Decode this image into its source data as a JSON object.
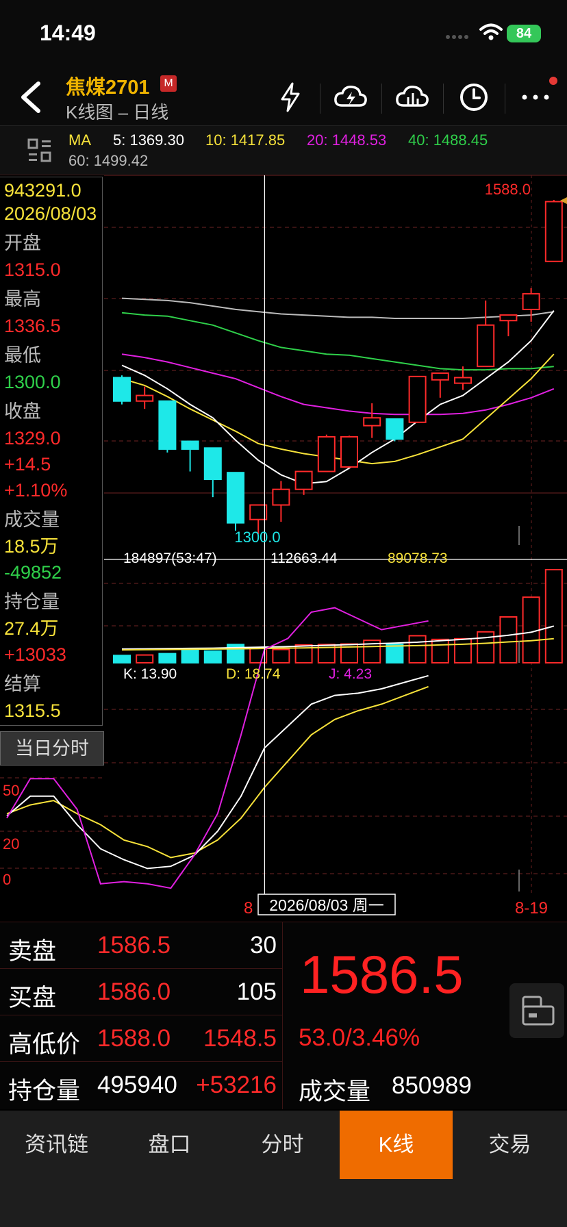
{
  "status_bar": {
    "time": "14:49",
    "battery": "84"
  },
  "header": {
    "title": "焦煤2701",
    "badge": "M",
    "subtitle": "K线图 – 日线"
  },
  "ma_bar": {
    "label": "MA",
    "ma5": "5: 1369.30",
    "ma10": "10: 1417.85",
    "ma20": "20: 1448.53",
    "ma40": "40: 1488.45",
    "ma60": "60: 1499.42"
  },
  "colors": {
    "up": "#ff2a2a",
    "down": "#1ee8e8",
    "ma5": "#ffffff",
    "ma10": "#f7e23a",
    "ma20": "#e020e0",
    "ma40": "#2fd04a",
    "ma60": "#bbbbbb",
    "accent": "#ef6c00"
  },
  "crosshair_info": {
    "value": "943291.0",
    "date": "2026/08/03",
    "open_label": "开盘",
    "open": "1315.0",
    "high_label": "最高",
    "high": "1336.5",
    "low_label": "最低",
    "low": "1300.0",
    "close_label": "收盘",
    "close": "1329.0",
    "change": "+14.5",
    "change_pct": "+1.10%",
    "volume_label": "成交量",
    "volume": "18.5万",
    "volume_change": "-49852",
    "oi_label": "持仓量",
    "oi": "27.4万",
    "oi_change": "+13033",
    "settle_label": "结算",
    "settle": "1315.5",
    "intraday_button": "当日分时"
  },
  "price_chart": {
    "max_label": "1588.0",
    "min_label": "1300.0",
    "candles": [
      {
        "o": 1429,
        "h": 1431,
        "l": 1405,
        "c": 1408
      },
      {
        "o": 1408,
        "h": 1421,
        "l": 1401,
        "c": 1413
      },
      {
        "o": 1408,
        "h": 1408,
        "l": 1362,
        "c": 1365
      },
      {
        "o": 1372,
        "h": 1372,
        "l": 1345,
        "c": 1365
      },
      {
        "o": 1366,
        "h": 1366,
        "l": 1322,
        "c": 1338
      },
      {
        "o": 1344,
        "h": 1344,
        "l": 1292,
        "c": 1299
      },
      {
        "o": 1302,
        "h": 1312,
        "l": 1289,
        "c": 1315
      },
      {
        "o": 1315,
        "h": 1336.5,
        "l": 1300,
        "c": 1329
      },
      {
        "o": 1329,
        "h": 1342,
        "l": 1324,
        "c": 1345
      },
      {
        "o": 1345,
        "h": 1378,
        "l": 1345,
        "c": 1376
      },
      {
        "o": 1349,
        "h": 1377,
        "l": 1349,
        "c": 1376
      },
      {
        "o": 1386,
        "h": 1406,
        "l": 1375,
        "c": 1393
      },
      {
        "o": 1392,
        "h": 1392,
        "l": 1372,
        "c": 1374
      },
      {
        "o": 1389,
        "h": 1429,
        "l": 1389,
        "c": 1430
      },
      {
        "o": 1427,
        "h": 1433,
        "l": 1411,
        "c": 1433
      },
      {
        "o": 1424,
        "h": 1439,
        "l": 1418,
        "c": 1429
      },
      {
        "o": 1439,
        "h": 1498,
        "l": 1439,
        "c": 1476
      },
      {
        "o": 1480,
        "h": 1485,
        "l": 1466,
        "c": 1485
      },
      {
        "o": 1490,
        "h": 1509,
        "l": 1479,
        "c": 1504
      },
      {
        "o": 1533,
        "h": 1588,
        "l": 1533,
        "c": 1586.5
      }
    ],
    "ma5": [
      1440,
      1431,
      1419,
      1405,
      1393,
      1373,
      1355,
      1342,
      1334,
      1336,
      1348,
      1362,
      1374,
      1390,
      1405,
      1413,
      1428,
      1443,
      1462,
      1489
    ],
    "ma10": [
      1428,
      1422,
      1412,
      1401,
      1391,
      1381,
      1370,
      1365,
      1361,
      1358,
      1355,
      1352,
      1354,
      1360,
      1367,
      1374,
      1392,
      1410,
      1428,
      1450
    ],
    "ma20": [
      1450,
      1447,
      1443,
      1438,
      1433,
      1428,
      1420,
      1412,
      1405,
      1402,
      1399,
      1397,
      1396,
      1396,
      1396,
      1397,
      1400,
      1405,
      1411,
      1419
    ],
    "ma40": [
      1487,
      1485,
      1484,
      1480,
      1476,
      1469,
      1462,
      1456,
      1453,
      1450,
      1449,
      1446,
      1443,
      1440,
      1437,
      1436,
      1436,
      1437,
      1437,
      1439
    ],
    "ma60": [
      1500,
      1499,
      1498,
      1496,
      1493,
      1490,
      1488,
      1486,
      1485,
      1484,
      1483,
      1483,
      1482,
      1482,
      1482,
      1482,
      1483,
      1484,
      1485,
      1488
    ]
  },
  "volume_chart": {
    "header_a": "184897(53:47)",
    "header_b": "112663.44",
    "header_c": "89078.73",
    "bars": [
      32000,
      34000,
      40000,
      55000,
      51000,
      80000,
      66000,
      58000,
      78000,
      80000,
      82000,
      98000,
      80000,
      118000,
      102000,
      105000,
      135000,
      200000,
      286000,
      406000
    ],
    "ma_white": [
      60000,
      61000,
      62000,
      63000,
      64000,
      66000,
      68000,
      70000,
      73000,
      76000,
      79000,
      83000,
      86000,
      90000,
      96000,
      102000,
      110000,
      120000,
      133000,
      160000
    ],
    "ma_yellow": [
      56000,
      57000,
      58000,
      59000,
      60000,
      61000,
      62000,
      64000,
      65000,
      67000,
      69000,
      71000,
      73000,
      75000,
      78000,
      81000,
      85000,
      91000,
      96000,
      105000
    ]
  },
  "kdj_chart": {
    "k_label": "K: 13.90",
    "d_label": "D: 18.74",
    "j_label": "J: 4.23",
    "y_labels": [
      "50",
      "20",
      "0"
    ],
    "k": [
      27,
      36,
      36,
      23,
      12,
      7,
      3,
      4,
      9,
      20,
      36,
      58,
      68,
      78,
      82,
      83,
      85,
      88,
      91
    ],
    "d": [
      28,
      32,
      34,
      28,
      23,
      16,
      13,
      8,
      10,
      16,
      26,
      40,
      52,
      64,
      71,
      75,
      78,
      82,
      86
    ],
    "j": [
      26,
      44,
      44,
      30,
      -4,
      -3,
      -4,
      -6,
      9,
      28,
      64,
      103,
      108,
      120,
      122,
      117,
      112,
      114,
      116
    ]
  },
  "x_axis": {
    "left_label": "8",
    "cursor_label": "2026/08/03 周一",
    "right_label": "8-19"
  },
  "quote": {
    "ask_label": "卖盘",
    "ask_price": "1586.5",
    "ask_qty": "30",
    "bid_label": "买盘",
    "bid_price": "1586.0",
    "bid_qty": "105",
    "hl_label": "高低价",
    "high_price": "1588.0",
    "low_price": "1548.5",
    "oi_label": "持仓量",
    "oi_value": "495940",
    "oi_change": "+53216",
    "last_price": "1586.5",
    "change": "53.0/3.46%",
    "volume_label": "成交量",
    "volume_value": "850989"
  },
  "tabs": [
    {
      "label": "资讯链"
    },
    {
      "label": "盘口"
    },
    {
      "label": "分时"
    },
    {
      "label": "K线"
    },
    {
      "label": "交易"
    }
  ]
}
